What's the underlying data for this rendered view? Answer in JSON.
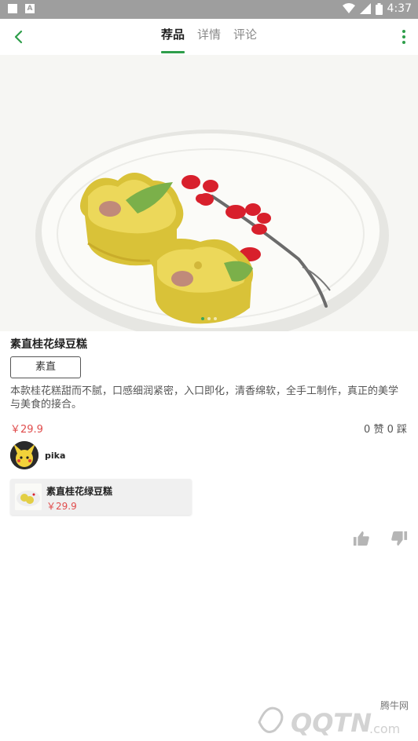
{
  "statusbar": {
    "time": "4:37"
  },
  "header": {
    "tabs": [
      {
        "label": "荐品",
        "active": true
      },
      {
        "label": "详情",
        "active": false
      },
      {
        "label": "评论",
        "active": false
      }
    ]
  },
  "product": {
    "title": "素直桂花绿豆糕",
    "tag": "素直",
    "description": "本款桂花糕甜而不腻，口感细润紧密，入口即化，清香绵软，全手工制作，真正的美学与美食的接合。",
    "price": "￥29.9",
    "votes": "0 赞 0 踩"
  },
  "author": {
    "name": "pika"
  },
  "related": {
    "title": "素直桂花绿豆糕",
    "price": "￥29.9"
  },
  "watermark": {
    "text": "腾牛网"
  },
  "colors": {
    "accent": "#2e9e4a",
    "price": "#e04c4c",
    "statusbar": "#9e9e9e"
  },
  "icons": [
    "back-arrow-icon",
    "more-vert-icon",
    "thumb-up-icon",
    "thumb-down-icon"
  ]
}
